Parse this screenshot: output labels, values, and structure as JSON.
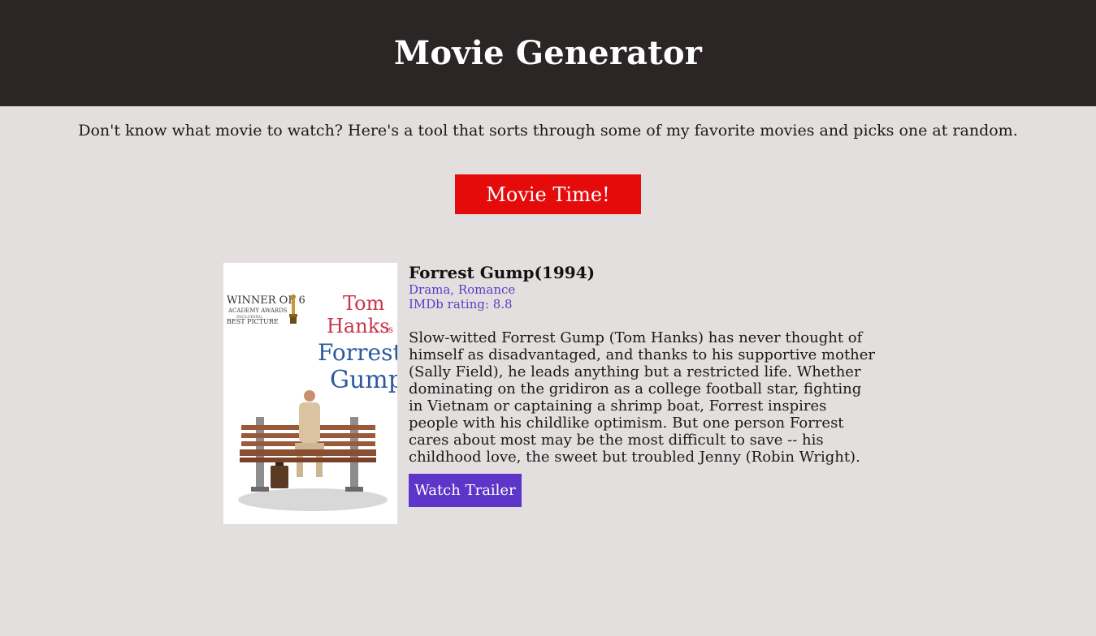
{
  "header": {
    "title": "Movie Generator"
  },
  "intro": {
    "text": "Don't know what movie to watch? Here's a tool that sorts through some of my favorite movies and picks one at random."
  },
  "actions": {
    "movie_time_label": "Movie Time!"
  },
  "movie": {
    "title": "Forrest Gump(1994)",
    "genres": "Drama, Romance",
    "rating": "IMDb rating: 8.8",
    "plot": "Slow-witted Forrest Gump (Tom Hanks) has never thought of himself as disadvantaged, and thanks to his supportive mother (Sally Field), he leads anything but a restricted life. Whether dominating on the gridiron as a college football star, fighting in Vietnam or captaining a shrimp boat, Forrest inspires people with his childlike optimism. But one person Forrest cares about most may be the most difficult to save -- his childhood love, the sweet but troubled Jenny (Robin Wright).",
    "trailer_label": "Watch Trailer",
    "poster": {
      "award_line1": "WINNER OF 6",
      "award_line2": "ACADEMY AWARDS",
      "award_line3": "INCLUDING",
      "award_line4": "BEST PICTURE",
      "name_line1": "Tom",
      "name_line2": "Hanks",
      "name_is": "is",
      "name_line3": "Forrest",
      "name_line4": "Gump"
    }
  },
  "colors": {
    "header_bg": "#2b2526",
    "page_bg": "#e3dfde",
    "movie_time_button": "#e50b0b",
    "trailer_button": "#5e35c9",
    "meta_text": "#5b3bc9"
  }
}
